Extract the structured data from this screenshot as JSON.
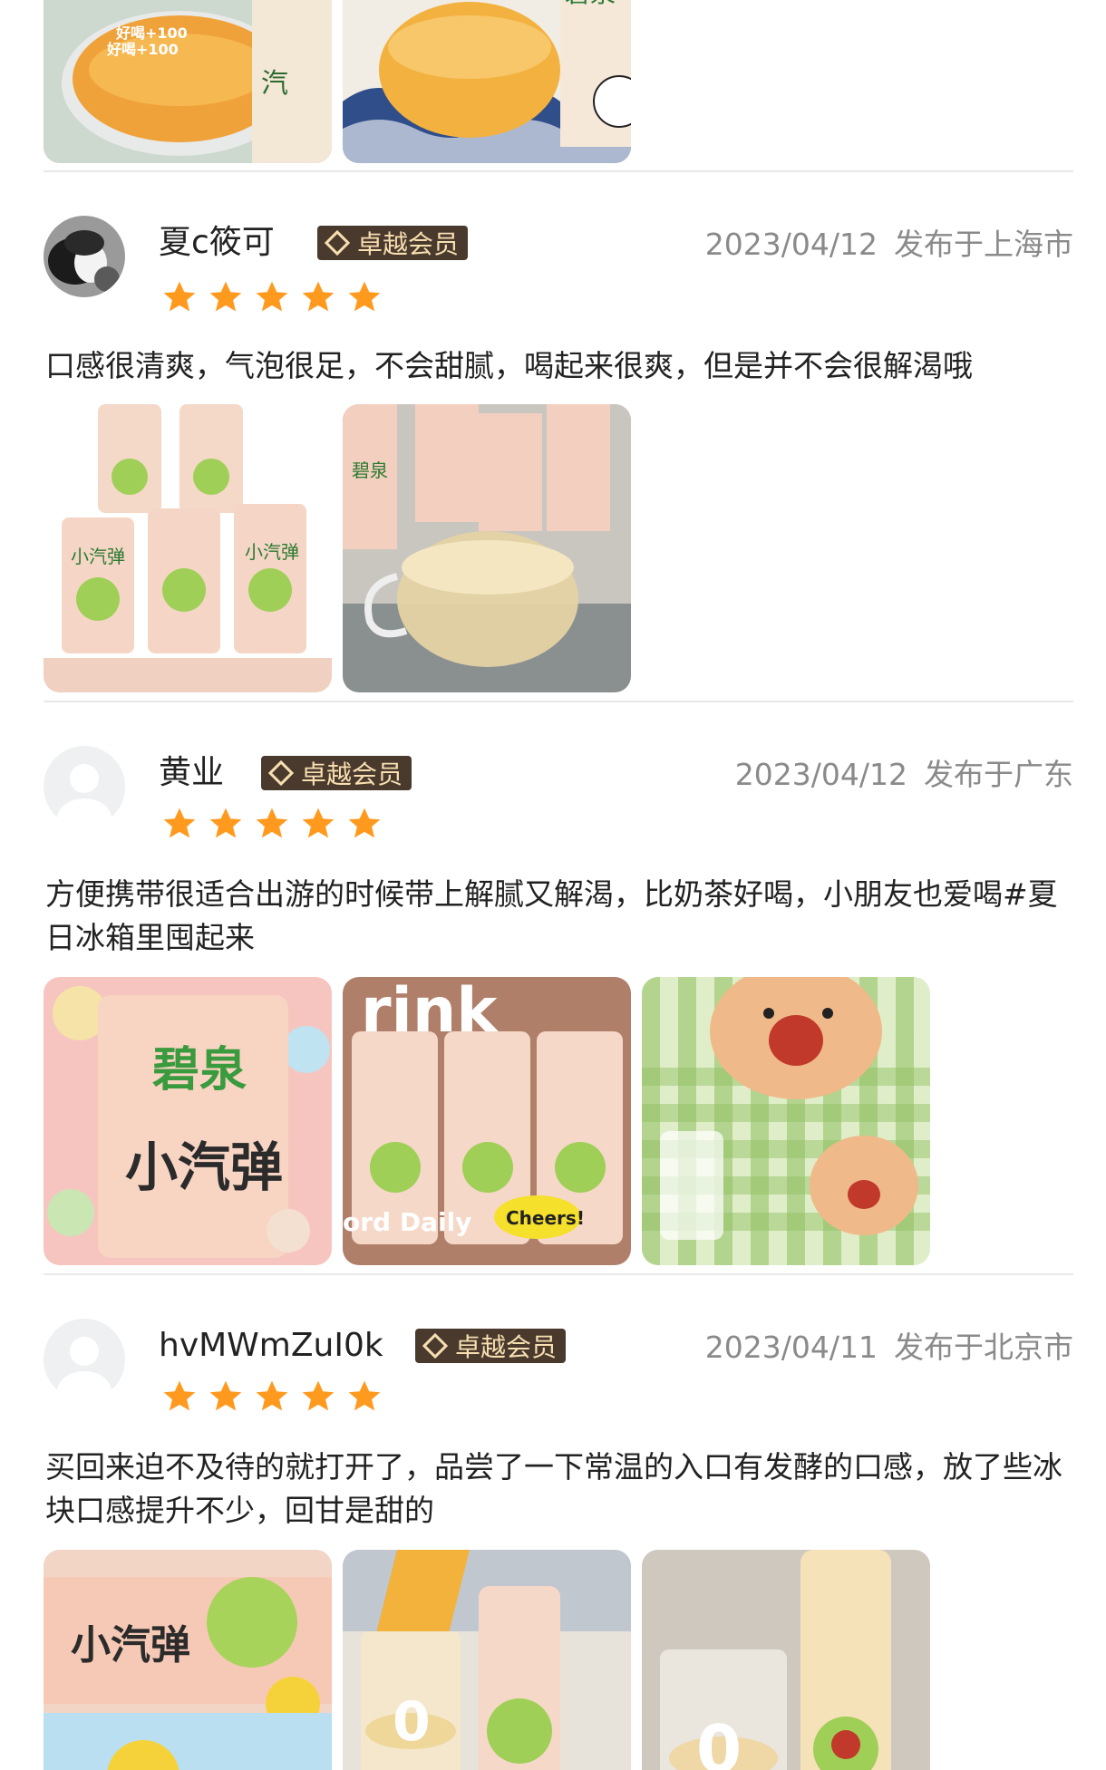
{
  "reviews": [
    {
      "username": "夏c筱可",
      "badge": "卓越会员",
      "date": "2023/04/12",
      "location": "发布于上海市",
      "rating": 5,
      "text": "口感很清爽，气泡很足，不会甜腻，喝起来很爽，但是并不会很解渴哦"
    },
    {
      "username": "黄业",
      "badge": "卓越会员",
      "date": "2023/04/12",
      "location": "发布于广东",
      "rating": 5,
      "text": "方便携带很适合出游的时候带上解腻又解渴，比奶茶好喝，小朋友也爱喝#夏日冰箱里囤起来"
    },
    {
      "username": "hvMWmZuI0k",
      "badge": "卓越会员",
      "date": "2023/04/11",
      "location": "发布于北京市",
      "rating": 5,
      "text": "买回来迫不及待的就打开了，品尝了一下常温的入口有发酵的口感，放了些冰块口感提升不少，回甘是甜的"
    }
  ],
  "image_text": {
    "good_plus": "好喝+100",
    "brand": "碧泉",
    "product": "小汽弹",
    "drink": "rink",
    "daily": "ord Daily",
    "cheers": "Cheers!",
    "zero": "0"
  },
  "colors": {
    "star": "#ff9a1f",
    "badge_bg": "#4a3a2e",
    "badge_text": "#f7dfb0",
    "meta": "#8a8a8a",
    "divider": "#e8e8e8"
  }
}
